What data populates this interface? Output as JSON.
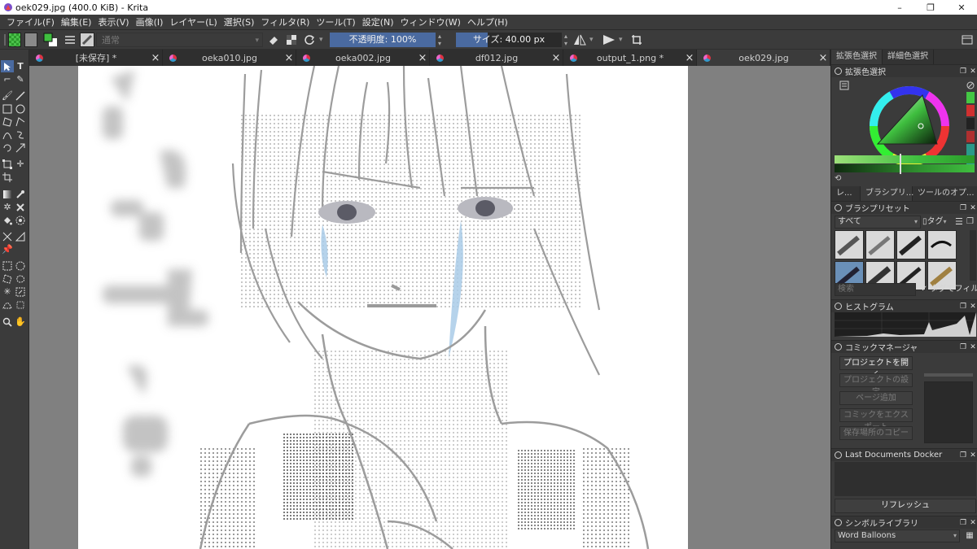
{
  "window": {
    "title": "oek029.jpg (400.0 KiB)  - Krita",
    "minimize": "–",
    "maximize": "❐",
    "close": "✕"
  },
  "menu": [
    "ファイル(F)",
    "編集(E)",
    "表示(V)",
    "画像(I)",
    "レイヤー(L)",
    "選択(S)",
    "フィルタ(R)",
    "ツール(T)",
    "設定(N)",
    "ウィンドウ(W)",
    "ヘルプ(H)"
  ],
  "tool_options": {
    "blend_mode": "通常",
    "opacity_label": "不透明度: 100%",
    "size_label": "サイズ: 40.00 px",
    "size_fraction": 0.3
  },
  "tabs": [
    {
      "label": "[未保存]  *",
      "active": false
    },
    {
      "label": "oeka010.jpg",
      "active": false
    },
    {
      "label": "oeka002.jpg",
      "active": false
    },
    {
      "label": "df012.jpg",
      "active": false
    },
    {
      "label": "output_1.png  *",
      "active": false
    },
    {
      "label": "oek029.jpg",
      "active": true
    }
  ],
  "dock": {
    "color_tabs": [
      "拡張色選択",
      "詳細色選択"
    ],
    "color_panel_title": "拡張色選択",
    "colors": {
      "accent": "#4a6aa0",
      "selector_green": "#3fbf3f",
      "palette": [
        "#44c744",
        "#d03030",
        "#222222",
        "#b03030",
        "#2a9a8a",
        "#30a0a0"
      ]
    },
    "mid_tabs": [
      "レ...",
      "ブラシプリ...",
      "ツールのオプ..."
    ],
    "brush_panel_title": "ブラシプリセット",
    "brush_filter": "すべて",
    "brush_tag_label": "タグ",
    "search_placeholder": "検索",
    "tag_filter_label": "タグでフィルタ",
    "histogram_title": "ヒストグラム",
    "comic_title": "コミックマネージャ",
    "comic_buttons": [
      {
        "label": "プロジェクトを開く",
        "enabled": true
      },
      {
        "label": "プロジェクトの設定",
        "enabled": false
      },
      {
        "label": "ページ追加",
        "enabled": false
      },
      {
        "label": "コミックをエクスポート",
        "enabled": false
      },
      {
        "label": "保存場所のコピー",
        "enabled": false
      }
    ],
    "last_docs_title": "Last Documents Docker",
    "refresh_label": "リフレッシュ",
    "symbol_title": "シンボルライブラリ",
    "symbol_set": "Word Balloons"
  }
}
